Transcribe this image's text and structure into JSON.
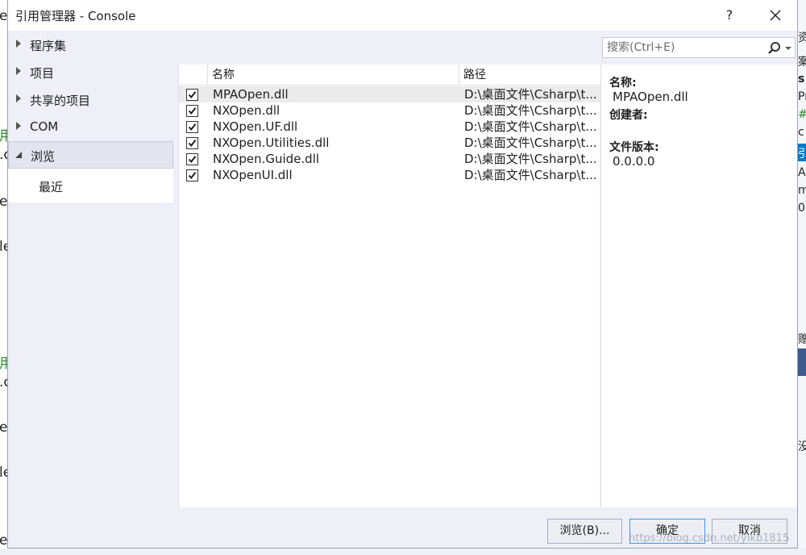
{
  "window": {
    "title": "引用管理器 - Console",
    "help_label": "?",
    "close_label": "✕"
  },
  "nav": {
    "items": [
      {
        "label": "程序集"
      },
      {
        "label": "项目"
      },
      {
        "label": "共享的项目"
      },
      {
        "label": "COM"
      },
      {
        "label": "浏览"
      }
    ],
    "sub_items": [
      {
        "label": "最近"
      }
    ]
  },
  "search": {
    "placeholder": "搜索(Ctrl+E)",
    "value": ""
  },
  "list": {
    "columns": [
      "名称",
      "路径"
    ],
    "rows": [
      {
        "checked": true,
        "name": "MPAOpen.dll",
        "path": "D:\\桌面文件\\Csharp\\t..."
      },
      {
        "checked": true,
        "name": "NXOpen.dll",
        "path": "D:\\桌面文件\\Csharp\\t..."
      },
      {
        "checked": true,
        "name": "NXOpen.UF.dll",
        "path": "D:\\桌面文件\\Csharp\\t..."
      },
      {
        "checked": true,
        "name": "NXOpen.Utilities.dll",
        "path": "D:\\桌面文件\\Csharp\\t..."
      },
      {
        "checked": true,
        "name": "NXOpen.Guide.dll",
        "path": "D:\\桌面文件\\Csharp\\t..."
      },
      {
        "checked": true,
        "name": "NXOpenUI.dll",
        "path": "D:\\桌面文件\\Csharp\\t..."
      }
    ]
  },
  "details": {
    "name_label": "名称:",
    "name_value": "MPAOpen.dll",
    "creator_label": "创建者:",
    "version_label": "文件版本:",
    "version_value": "0.0.0.0"
  },
  "buttons": {
    "browse": "浏览(B)...",
    "ok": "确定",
    "cancel": "取消"
  },
  "watermark": "https://blog.csdn.net/ylkb1815",
  "background": {
    "left_fragments": [
      "e",
      "用",
      ".c",
      "e",
      "le",
      "用",
      ".c",
      "e",
      "le",
      "e()"
    ],
    "right_fragments": [
      "资",
      "案",
      "s",
      "Pr",
      "#",
      "c",
      "引",
      "AF",
      "m",
      "06",
      "赠",
      "没"
    ]
  },
  "colors": {
    "accent": "#3399ff",
    "dialog_bg": "#eeeff7",
    "selected_row": "#ebebeb"
  }
}
